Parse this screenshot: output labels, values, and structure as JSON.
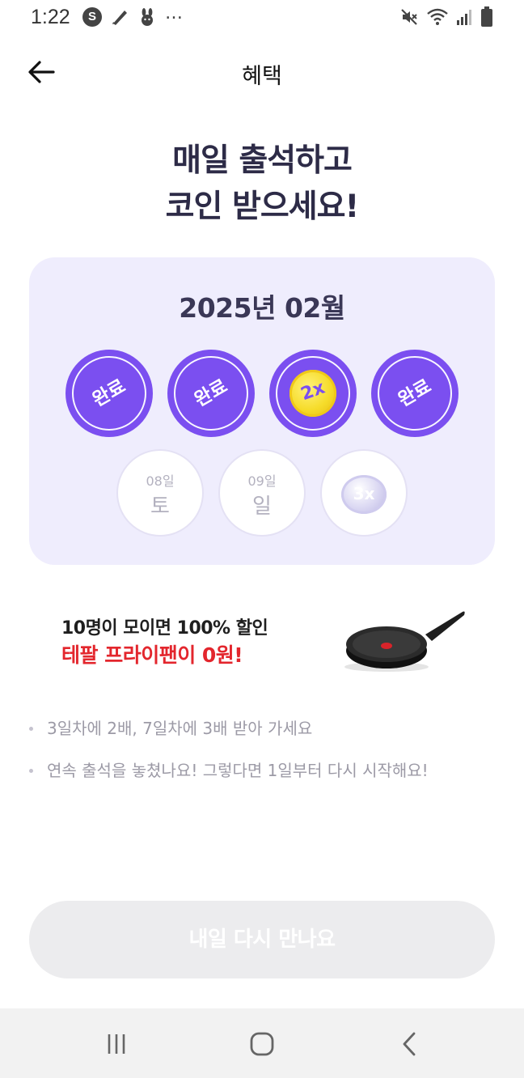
{
  "status_bar": {
    "time": "1:22",
    "left_icons": [
      "s-app-icon",
      "pen-app-icon",
      "rabbit-app-icon"
    ],
    "overflow": "…",
    "right_icons": [
      "mute-icon",
      "wifi-icon",
      "signal-icon",
      "battery-icon"
    ]
  },
  "header": {
    "title": "혜택",
    "back_icon": "arrow-left-icon"
  },
  "headline": {
    "line1": "매일 출석하고",
    "line2": "코인 받으세요!"
  },
  "calendar": {
    "month_label": "2025년 02월",
    "done_label": "완료",
    "bonus_2x": "2x",
    "days": [
      {
        "state": "done",
        "label": "완료"
      },
      {
        "state": "done",
        "label": "완료"
      },
      {
        "state": "bonus",
        "label": "2x"
      },
      {
        "state": "done",
        "label": "완료"
      },
      {
        "state": "future",
        "date": "08일",
        "weekday": "토"
      },
      {
        "state": "future",
        "date": "09일",
        "weekday": "일"
      },
      {
        "state": "future-bonus",
        "label": "3x"
      }
    ],
    "colors": {
      "accent": "#7b4ff0",
      "card_bg": "#efedfd",
      "coin_gold": "#f6dc2a"
    }
  },
  "banner": {
    "line1": "10명이 모이면 100% 할인",
    "line2": "테팔 프라이팬이 0원!",
    "image": "frying-pan"
  },
  "notes": [
    "3일차에 2배, 7일차에 3배 받아 가세요",
    "연속 출석을 놓쳤나요! 그렇다면 1일부터 다시 시작해요!"
  ],
  "cta": {
    "label": "내일 다시 만나요"
  },
  "navbar": {
    "buttons": [
      "recent-apps-icon",
      "home-icon",
      "back-icon"
    ]
  }
}
